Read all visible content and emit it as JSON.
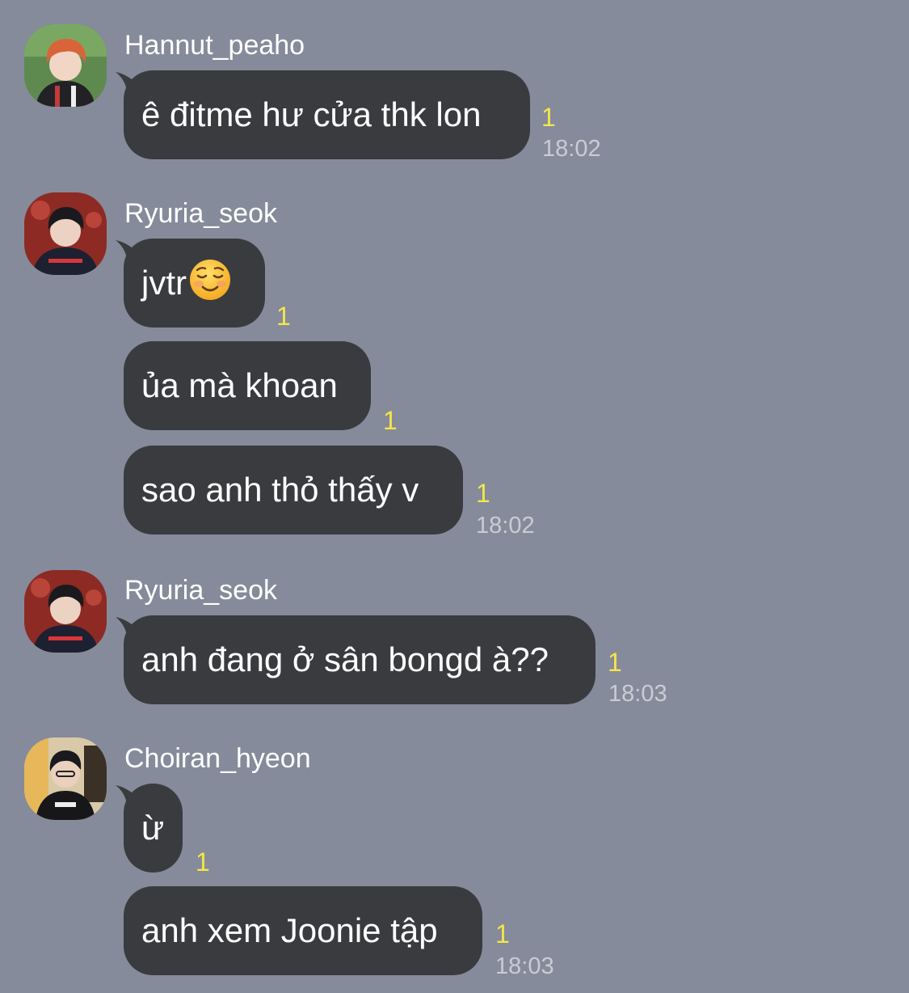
{
  "chat": {
    "groups": [
      {
        "sender": "Hannut_peaho",
        "messages": [
          {
            "text": "ê đitme hư cửa thk lon",
            "unread": "1",
            "time": "18:02"
          }
        ]
      },
      {
        "sender": "Ryuria_seok",
        "messages": [
          {
            "text": "jvtr",
            "emoji": "smiling-face-emoji",
            "unread": "1"
          },
          {
            "text": "ủa mà khoan",
            "unread": "1"
          },
          {
            "text": "sao anh thỏ thấy v",
            "unread": "1",
            "time": "18:02"
          }
        ]
      },
      {
        "sender": "Ryuria_seok",
        "messages": [
          {
            "text": "anh đang ở sân bongd à??",
            "unread": "1",
            "time": "18:03"
          }
        ]
      },
      {
        "sender": "Choiran_hyeon",
        "messages": [
          {
            "text": "ừ",
            "unread": "1"
          },
          {
            "text": "anh xem Joonie tập",
            "unread": "1",
            "time": "18:03"
          }
        ]
      }
    ]
  },
  "colors": {
    "background": "#858b9a",
    "bubble": "#3a3b3f",
    "unread": "#f5e54a",
    "time": "#c9ccd3"
  }
}
